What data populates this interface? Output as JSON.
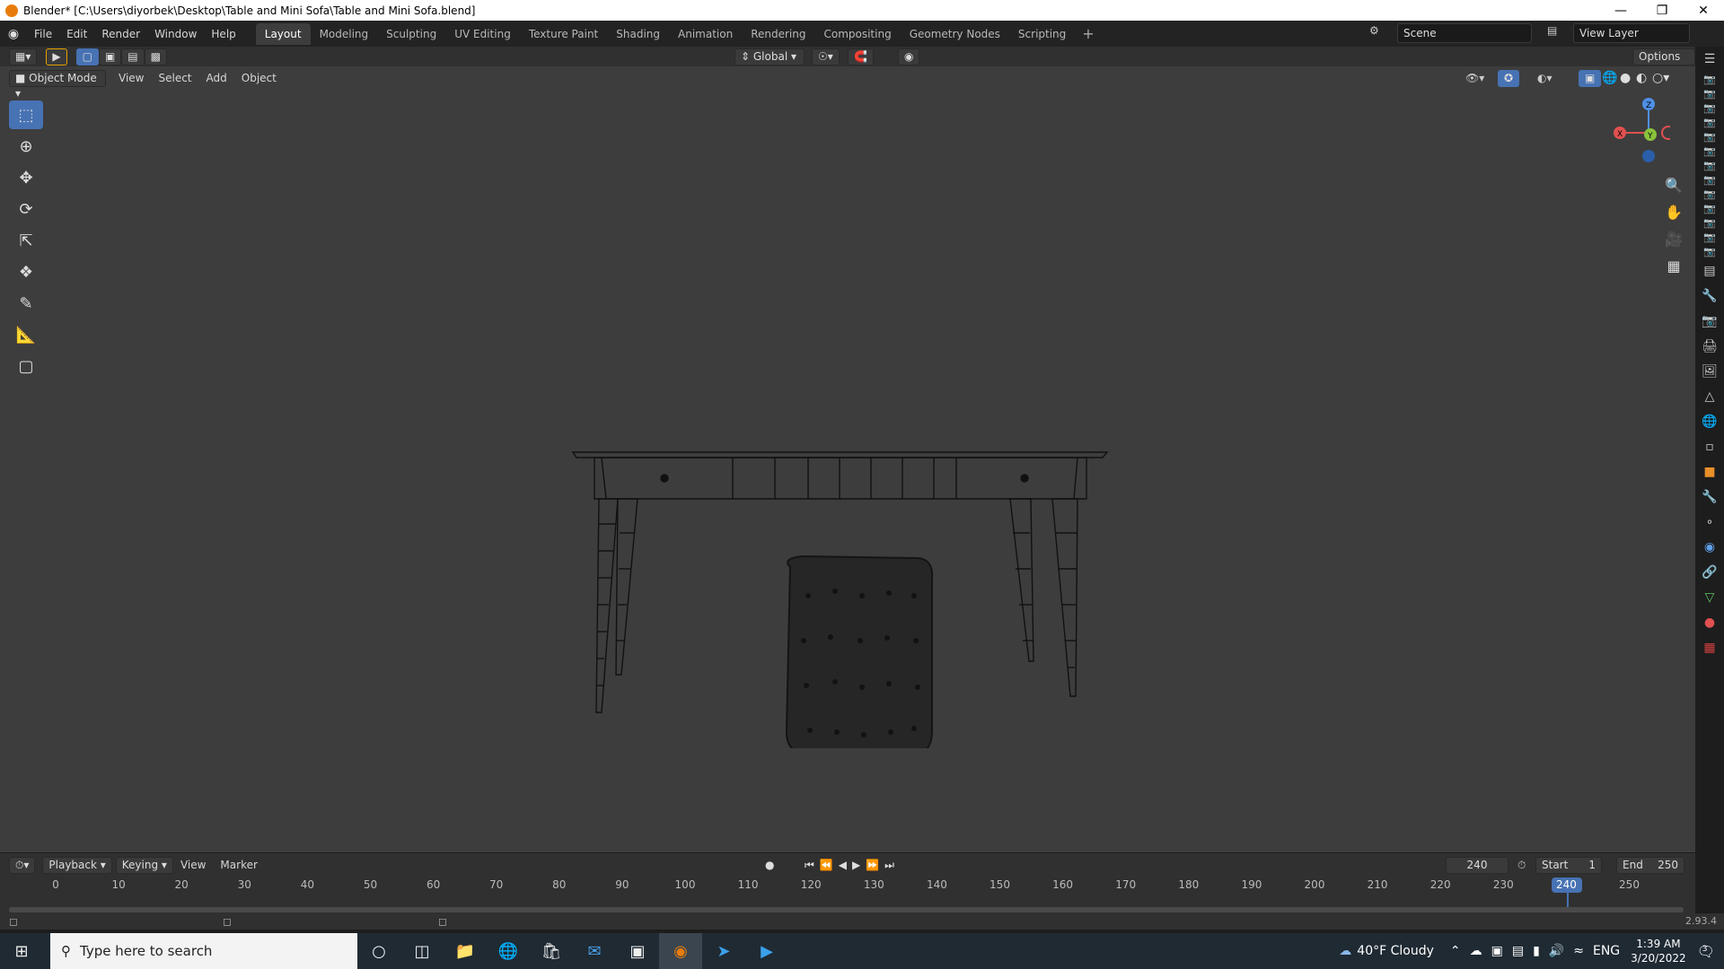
{
  "window": {
    "title": "Blender* [C:\\Users\\diyorbek\\Desktop\\Table and Mini Sofa\\Table and Mini Sofa.blend]"
  },
  "menu": {
    "items": [
      "File",
      "Edit",
      "Render",
      "Window",
      "Help"
    ]
  },
  "workspaces": {
    "tabs": [
      "Layout",
      "Modeling",
      "Sculpting",
      "UV Editing",
      "Texture Paint",
      "Shading",
      "Animation",
      "Rendering",
      "Compositing",
      "Geometry Nodes",
      "Scripting"
    ],
    "active": "Layout"
  },
  "scene": {
    "name": "Scene",
    "view_layer": "View Layer"
  },
  "viewport_header": {
    "transform_orientation": "Global",
    "options_label": "Options",
    "mode": "Object Mode",
    "menus": [
      "View",
      "Select",
      "Add",
      "Object"
    ]
  },
  "gizmo": {
    "z": "Z",
    "y": "Y",
    "x": "X"
  },
  "timeline": {
    "menus": [
      "Playback",
      "Keying",
      "View",
      "Marker"
    ],
    "current_frame": "240",
    "start_label": "Start",
    "start_value": "1",
    "end_label": "End",
    "end_value": "250",
    "ticks": [
      "0",
      "10",
      "20",
      "30",
      "40",
      "50",
      "60",
      "70",
      "80",
      "90",
      "100",
      "110",
      "120",
      "130",
      "140",
      "150",
      "160",
      "170",
      "180",
      "190",
      "200",
      "210",
      "220",
      "230",
      "240",
      "250"
    ]
  },
  "status": {
    "version": "2.93.4"
  },
  "taskbar": {
    "search_placeholder": "Type here to search",
    "weather": "40°F  Cloudy",
    "lang": "ENG",
    "time": "1:39 AM",
    "date": "3/20/2022",
    "notif_count": "3"
  },
  "colors": {
    "accent": "#4772b3",
    "viewport": "#3d3d3d",
    "frame_marker": "#4772b3"
  }
}
